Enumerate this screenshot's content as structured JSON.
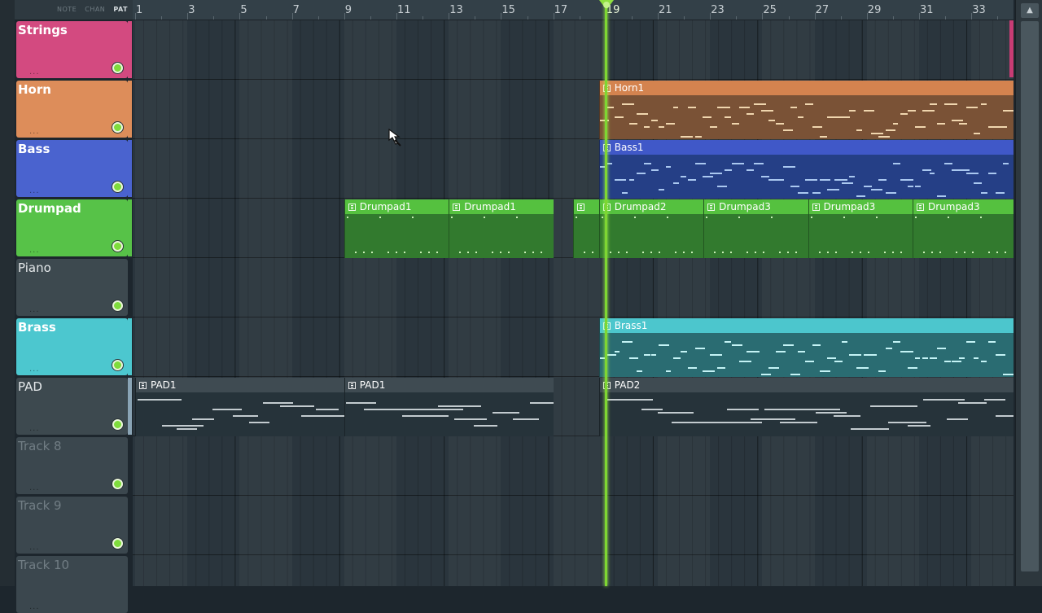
{
  "header": {
    "tabs": [
      {
        "label": "NOTE",
        "active": false
      },
      {
        "label": "CHAN",
        "active": false
      },
      {
        "label": "PAT",
        "active": true
      }
    ]
  },
  "ruler": {
    "bars": [
      "1",
      "3",
      "5",
      "7",
      "9",
      "11",
      "13",
      "15",
      "17",
      "19",
      "21",
      "23",
      "25",
      "27",
      "29",
      "31",
      "33"
    ]
  },
  "playhead_bar": 19,
  "tracks": [
    {
      "name": "Strings",
      "color": "#d34a80",
      "style": "color"
    },
    {
      "name": "Horn",
      "color": "#dd8d5a",
      "style": "color"
    },
    {
      "name": "Bass",
      "color": "#4a63cf",
      "style": "color"
    },
    {
      "name": "Drumpad",
      "color": "#57c248",
      "style": "color"
    },
    {
      "name": "Piano",
      "color": "#3d494f",
      "style": "dark"
    },
    {
      "name": "Brass",
      "color": "#4cc7cf",
      "style": "color"
    },
    {
      "name": "PAD",
      "color": "#3d494f",
      "style": "dark"
    },
    {
      "name": "Track 8",
      "color": "#3b474e",
      "style": "empty"
    },
    {
      "name": "Track 9",
      "color": "#3b474e",
      "style": "empty"
    },
    {
      "name": "Track 10",
      "color": "#3b474e",
      "style": "empty"
    }
  ],
  "clips": [
    {
      "label": "Horn1",
      "track": 1,
      "start": 18.75,
      "end": 36,
      "title_color": "#d4834f",
      "body_color": "#7a5236",
      "note_color": "#f0d6ae"
    },
    {
      "label": "Bass1",
      "track": 2,
      "start": 18.75,
      "end": 36,
      "title_color": "#4058c8",
      "body_color": "#253f86",
      "note_color": "#aac8f0"
    },
    {
      "label": "Drumpad1",
      "track": 3,
      "start": 9,
      "end": 13,
      "title_color": "#55c13f",
      "body_color": "#327a2e",
      "note_color": "#c9f0b6"
    },
    {
      "label": "Drumpad1",
      "track": 3,
      "start": 13,
      "end": 17,
      "title_color": "#55c13f",
      "body_color": "#327a2e",
      "note_color": "#c9f0b6"
    },
    {
      "label": "",
      "track": 3,
      "start": 17.75,
      "end": 18.75,
      "title_color": "#55c13f",
      "body_color": "#327a2e",
      "note_color": "#c9f0b6"
    },
    {
      "label": "Drumpad2",
      "track": 3,
      "start": 18.75,
      "end": 22.75,
      "title_color": "#55c13f",
      "body_color": "#327a2e",
      "note_color": "#c9f0b6"
    },
    {
      "label": "Drumpad3",
      "track": 3,
      "start": 22.75,
      "end": 26.75,
      "title_color": "#55c13f",
      "body_color": "#327a2e",
      "note_color": "#c9f0b6"
    },
    {
      "label": "Drumpad3",
      "track": 3,
      "start": 26.75,
      "end": 30.75,
      "title_color": "#55c13f",
      "body_color": "#327a2e",
      "note_color": "#c9f0b6"
    },
    {
      "label": "Drumpad3",
      "track": 3,
      "start": 30.75,
      "end": 36,
      "title_color": "#55c13f",
      "body_color": "#327a2e",
      "note_color": "#c9f0b6"
    },
    {
      "label": "Brass1",
      "track": 5,
      "start": 18.75,
      "end": 36,
      "title_color": "#4cc6cd",
      "body_color": "#2a6c72",
      "note_color": "#c4f3f5"
    },
    {
      "label": "PAD1",
      "track": 6,
      "start": 1,
      "end": 9,
      "title_color": "#3f4b52",
      "body_color": "#26333a",
      "note_color": "#c3cbcf"
    },
    {
      "label": "PAD1",
      "track": 6,
      "start": 9,
      "end": 17,
      "title_color": "#3f4b52",
      "body_color": "#26333a",
      "note_color": "#c3cbcf"
    },
    {
      "label": "PAD2",
      "track": 6,
      "start": 18.75,
      "end": 36,
      "title_color": "#3f4b52",
      "body_color": "#26333a",
      "note_color": "#c3cbcf"
    }
  ]
}
